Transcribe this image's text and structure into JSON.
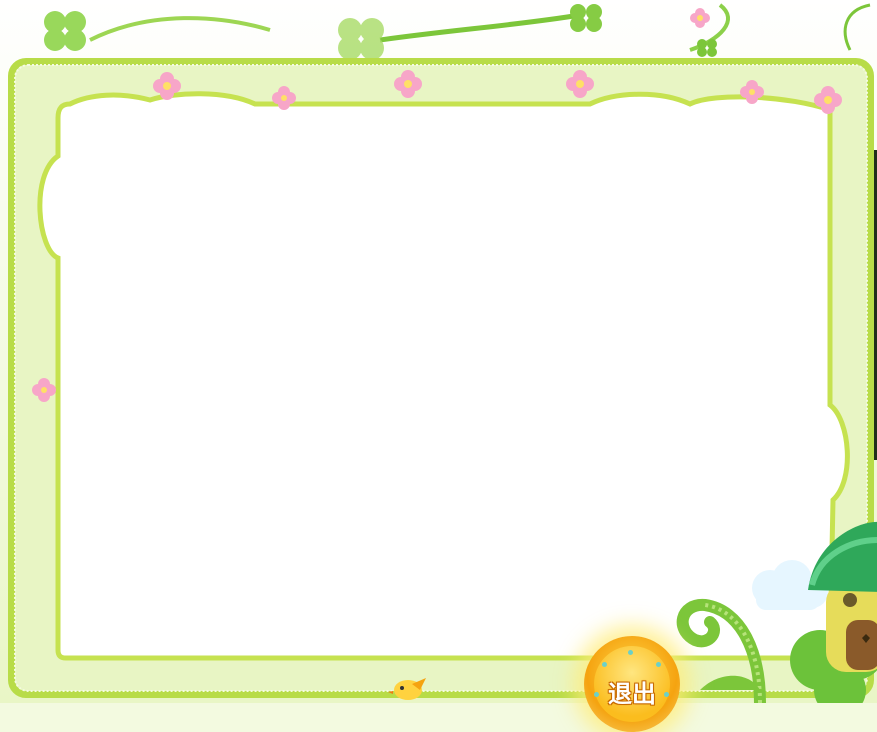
{
  "scene": {
    "background_color": "#f3fae0",
    "frame_color": "#b8dc48",
    "panel_color": "#ffffff",
    "panel_border_color": "#b8dc48",
    "flower_color": "#f7a6c8",
    "leaf_color": "#8fd44a"
  },
  "exit_button": {
    "label": "退出",
    "color": "#f5a310",
    "icon": "gold-coin-icon"
  },
  "decorations": {
    "clover": "clover-icon",
    "flower": "flower-icon",
    "bird": "bird-icon",
    "mushroom_house": "mushroom-house-icon",
    "vine": "vine-icon",
    "cloud": "cloud-icon"
  }
}
